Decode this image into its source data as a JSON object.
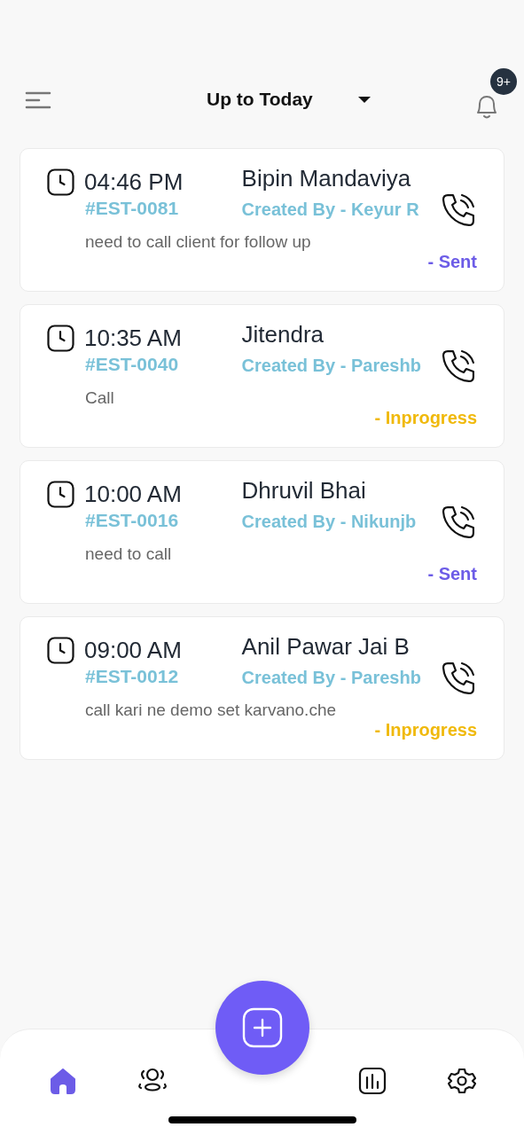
{
  "header": {
    "filter": "Up to Today",
    "notification_badge": "9+"
  },
  "appointments": [
    {
      "time": "04:46 PM",
      "id": "#EST-0081",
      "name": "Bipin Mandaviya",
      "created_by": "Created By - Keyur R",
      "note": "need to call client for follow up",
      "status": "- Sent",
      "color": "#6c5ce7"
    },
    {
      "time": "10:35 AM",
      "id": "#EST-0040",
      "name": "Jitendra",
      "created_by": "Created By - Pareshb",
      "note": "Call",
      "status": "- Inprogress",
      "color": "#f0b90b"
    },
    {
      "time": "10:00 AM",
      "id": "#EST-0016",
      "name": "Dhruvil Bhai",
      "created_by": "Created By - Nikunjb",
      "note": "need to call",
      "status": "- Sent",
      "color": "#6c5ce7"
    },
    {
      "time": "09:00 AM",
      "id": "#EST-0012",
      "name": "Anil Pawar Jai B",
      "created_by": "Created By - Pareshb",
      "note": "call kari ne demo set karvano.che",
      "status": "- Inprogress",
      "color": "#f0b90b"
    }
  ],
  "bottom_nav": [
    {
      "kind": "home",
      "selected": true
    },
    {
      "kind": "people",
      "selected": false
    },
    {
      "kind": "add"
    },
    {
      "kind": "chart",
      "selected": false
    },
    {
      "kind": "settings",
      "selected": false
    }
  ]
}
